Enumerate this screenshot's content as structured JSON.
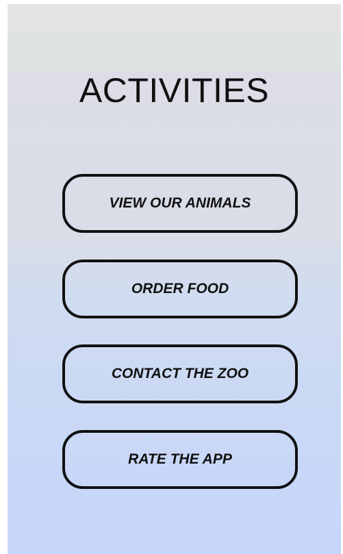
{
  "header": {
    "title": "ACTIVITIES"
  },
  "menu": {
    "items": [
      {
        "label": "VIEW OUR ANIMALS"
      },
      {
        "label": "ORDER FOOD"
      },
      {
        "label": "CONTACT THE ZOO"
      },
      {
        "label": "RATE THE APP"
      }
    ]
  },
  "colors": {
    "text": "#111111",
    "border": "#111111",
    "top_bar": "#e2e3e2",
    "gradient_top": "#dcdde6",
    "gradient_bottom": "#c6d6fb"
  }
}
